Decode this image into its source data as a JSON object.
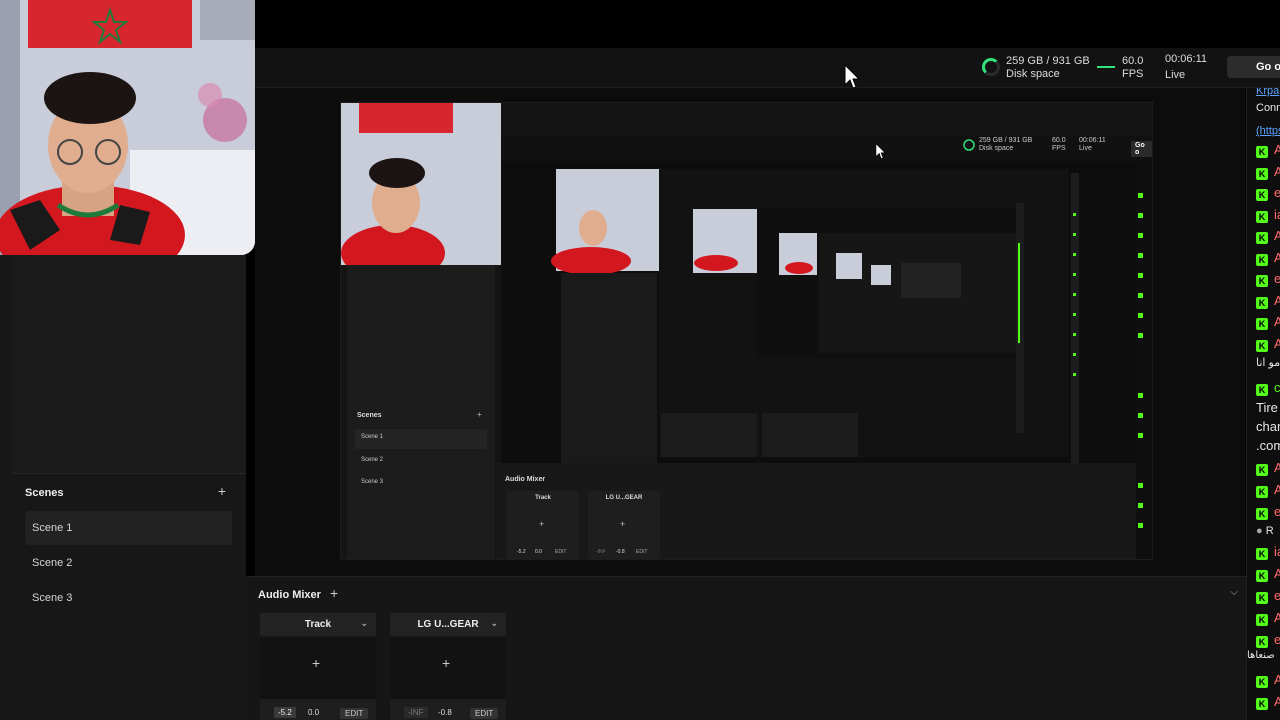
{
  "status": {
    "disk_value": "259 GB / 931 GB",
    "disk_label": "Disk space",
    "fps_value": "60.0",
    "fps_label": "FPS",
    "live_time": "00:06:11",
    "live_label": "Live",
    "go_button": "Go o",
    "accent": "#2fe27a"
  },
  "scenes": {
    "title": "Scenes",
    "add": "+",
    "items": [
      "Scene 1",
      "Scene 2",
      "Scene 3"
    ]
  },
  "mixer": {
    "title": "Audio Mixer",
    "add": "+",
    "tracks": [
      {
        "name": "Track",
        "vol": "-5.2",
        "gain": "0.0",
        "edit": "EDIT"
      },
      {
        "name": "LG U...GEAR",
        "vol": "-INF",
        "gain": "-0.8",
        "edit": "EDIT"
      }
    ]
  },
  "nested": {
    "disk_value": "259 GB / 931 GB",
    "disk_label": "Disk space",
    "fps_value": "60.0",
    "fps_label": "FPS",
    "live_time": "00:06:11",
    "live_label": "Live",
    "go_button": "Go o",
    "scenes_title": "Scenes",
    "scene_items": [
      "Scene 1",
      "Scene 2",
      "Scene 3"
    ],
    "mixer_title": "Audio Mixer",
    "tracks": [
      {
        "name": "Track",
        "vol": "-5.2",
        "gain": "0.0",
        "edit": "EDIT"
      },
      {
        "name": "LG U...GEAR",
        "vol": "-INF",
        "gain": "-0.8",
        "edit": "EDIT"
      }
    ]
  },
  "chat": {
    "link_top": "Krpa",
    "conn": "Conn",
    "link_https": "(https",
    "rows": [
      {
        "type": "kick",
        "text": "A",
        "color": "#ff6a6a"
      },
      {
        "type": "kick",
        "text": "A",
        "color": "#ff6a6a"
      },
      {
        "type": "kick",
        "text": "e",
        "color": "#ff6a6a"
      },
      {
        "type": "kick",
        "text": "ia",
        "color": "#ff6a6a"
      },
      {
        "type": "kick",
        "text": "A",
        "color": "#ff6a6a"
      },
      {
        "type": "kick",
        "text": "A",
        "color": "#ff6a6a"
      },
      {
        "type": "kick",
        "text": "e",
        "color": "#ff6a6a"
      },
      {
        "type": "kick",
        "text": "A",
        "color": "#ff6a6a"
      },
      {
        "type": "kick",
        "text": "A",
        "color": "#ff6a6a"
      },
      {
        "type": "kick",
        "text": "A",
        "color": "#ff6a6a"
      }
    ],
    "arabic_1": "مو انا",
    "row_g": "c",
    "tired_1": "Tire",
    "tired_2": "char",
    "tired_3": ".com",
    "rows2": [
      "A",
      "A",
      "e"
    ],
    "reply": "R",
    "rows3": [
      "ia",
      "A",
      "e",
      "A",
      "e"
    ],
    "arabic_2": "صنعاها",
    "rows4": [
      "A",
      "A"
    ]
  }
}
